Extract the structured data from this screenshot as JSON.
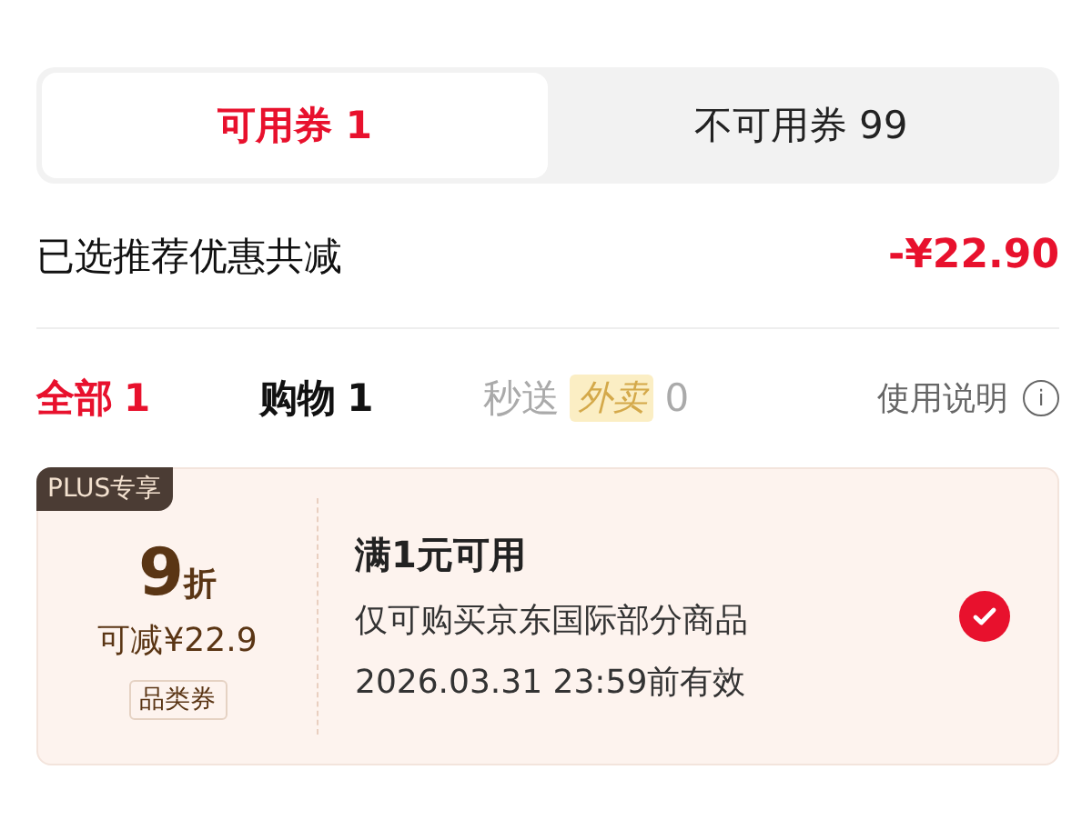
{
  "segments": [
    {
      "label": "可用券 1",
      "selected": true
    },
    {
      "label": "不可用券 99",
      "selected": false
    }
  ],
  "summary": {
    "label": "已选推荐优惠共减",
    "amount": "-¥22.90"
  },
  "filters": [
    {
      "label": "全部",
      "count": "1",
      "selected": true,
      "disabled": false
    },
    {
      "label": "购物",
      "count": "1",
      "selected": false,
      "disabled": false
    },
    {
      "label": "秒送",
      "tag": "外卖",
      "count": "0",
      "selected": false,
      "disabled": true
    }
  ],
  "help": {
    "label": "使用说明",
    "icon": "i"
  },
  "coupon": {
    "badge": "PLUS专享",
    "value": "9",
    "unit": "折",
    "saving": "可减¥22.9",
    "type": "品类券",
    "title": "满1元可用",
    "scope": "仅可购买京东国际部分商品",
    "expiry": "2026.03.31 23:59前有效",
    "checked": true
  }
}
